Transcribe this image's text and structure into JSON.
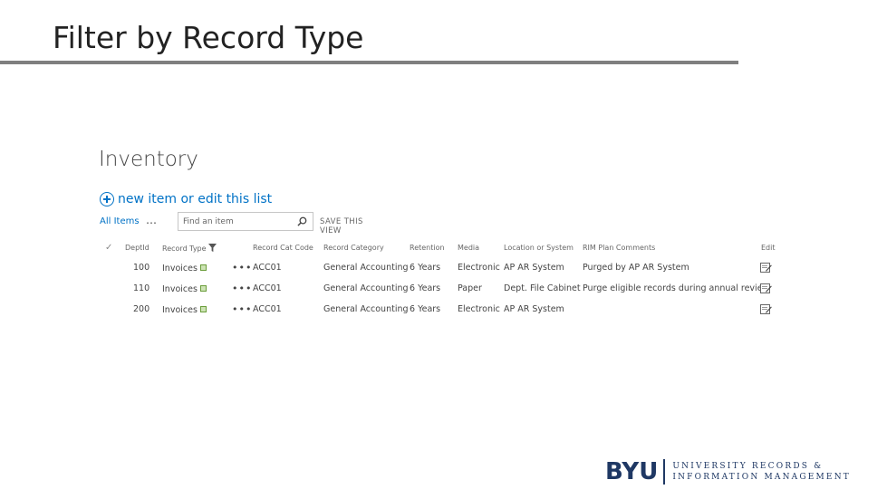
{
  "slide": {
    "title": "Filter by Record Type"
  },
  "list": {
    "title": "Inventory",
    "new_item_label": "new item or edit this list",
    "view_label": "All Items",
    "view_menu": "…",
    "search_placeholder": "Find an item",
    "save_view_label": "SAVE THIS VIEW",
    "columns": {
      "check": "✓",
      "dept_id": "DeptId",
      "record_type": "Record Type",
      "record_cat_code": "Record Cat Code",
      "record_category": "Record Category",
      "retention": "Retention",
      "media": "Media",
      "location": "Location or System",
      "rim_comments": "RIM Plan Comments",
      "edit": "Edit"
    },
    "rows": [
      {
        "dept_id": "100",
        "record_type": "Invoices",
        "menu": "•••",
        "record_cat_code": "ACC01",
        "record_category": "General Accounting",
        "retention": "6 Years",
        "media": "Electronic",
        "location": "AP AR System",
        "rim_comments": "Purged by AP AR System"
      },
      {
        "dept_id": "110",
        "record_type": "Invoices",
        "menu": "•••",
        "record_cat_code": "ACC01",
        "record_category": "General Accounting",
        "retention": "6 Years",
        "media": "Paper",
        "location": "Dept. File Cabinet",
        "rim_comments": "Purge eligible records during annual review"
      },
      {
        "dept_id": "200",
        "record_type": "Invoices",
        "menu": "•••",
        "record_cat_code": "ACC01",
        "record_category": "General Accounting",
        "retention": "6 Years",
        "media": "Electronic",
        "location": "AP AR System",
        "rim_comments": ""
      }
    ]
  },
  "footer": {
    "logo_mark": "BYU",
    "logo_line1": "UNIVERSITY RECORDS &",
    "logo_line2": "INFORMATION MANAGEMENT"
  },
  "colors": {
    "link": "#0072c6",
    "title_rule": "#7f7f7f",
    "brand_navy": "#1f3864"
  },
  "icons": {
    "new_item": "plus-circle-icon",
    "search": "search-icon",
    "filter": "filter-icon",
    "attachment": "new-item-icon",
    "edit": "edit-icon"
  }
}
